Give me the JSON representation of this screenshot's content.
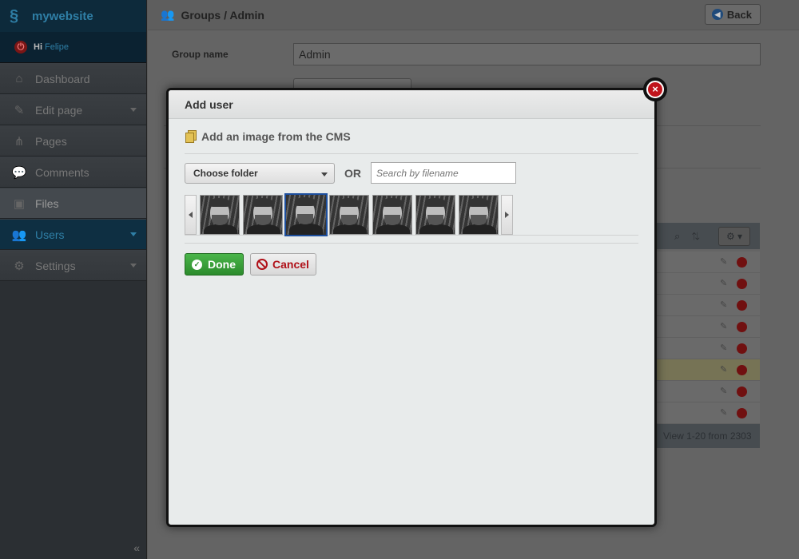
{
  "sidebar": {
    "brand": "mywebsite",
    "greeting": "Hi",
    "user": "Felipe",
    "items": [
      {
        "label": "Dashboard"
      },
      {
        "label": "Edit page"
      },
      {
        "label": "Pages"
      },
      {
        "label": "Comments"
      },
      {
        "label": "Files"
      },
      {
        "label": "Users"
      },
      {
        "label": "Settings"
      }
    ],
    "collapse_glyph": "«"
  },
  "header": {
    "title": "Groups / Admin",
    "back_label": "Back"
  },
  "form": {
    "group_name_label": "Group name",
    "group_name_value": "Admin"
  },
  "table": {
    "footer": "View 1-20 from 2303"
  },
  "modal": {
    "title": "Add user",
    "section_title": "Add an image from the CMS",
    "folder_select": "Choose folder",
    "or_label": "OR",
    "search_placeholder": "Search by filename",
    "thumbnails_count": 7,
    "selected_thumbnail": 3,
    "done_label": "Done",
    "cancel_label": "Cancel"
  },
  "colors": {
    "brand_blue": "#2f7fa6",
    "done_green": "#2c8b2c",
    "cancel_red": "#b01018",
    "close_red": "#c0141c"
  }
}
